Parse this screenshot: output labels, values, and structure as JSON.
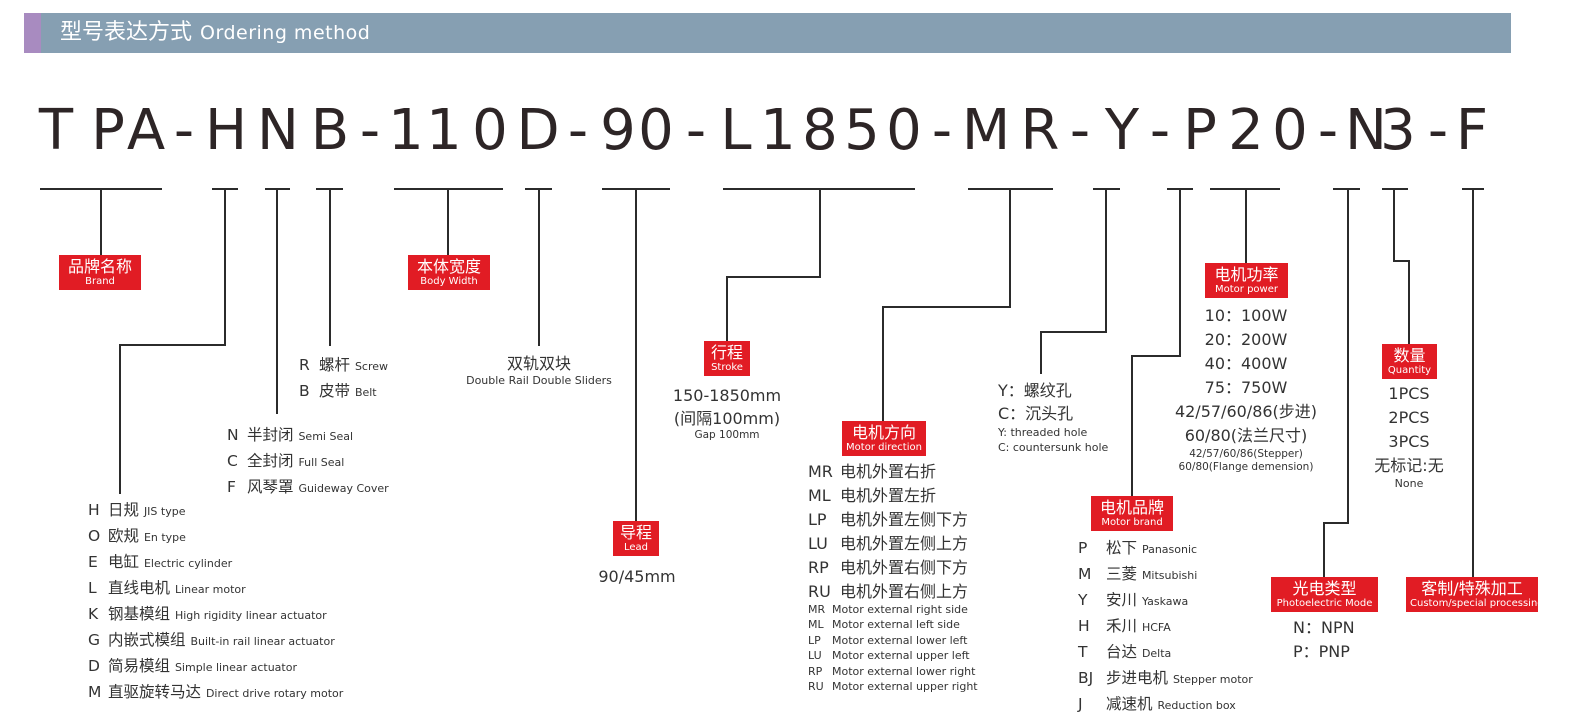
{
  "header": {
    "title_zh": "型号表达方式",
    "title_en": "Ordering method"
  },
  "model_code": [
    "T",
    "P",
    "A",
    "-",
    "H",
    "N",
    "B",
    "-",
    "1",
    "1",
    "0",
    "D",
    "-",
    "9",
    "0",
    "-",
    "L",
    "1",
    "8",
    "5",
    "0",
    "-",
    "M",
    "R",
    "-",
    "Y",
    "-",
    "P",
    "2",
    "0",
    "-",
    "N",
    "3",
    "-",
    "F"
  ],
  "tags": {
    "brand": {
      "zh": "品牌名称",
      "en": "Brand"
    },
    "body_width": {
      "zh": "本体宽度",
      "en": "Body Width"
    },
    "stroke": {
      "zh": "行程",
      "en": "Stroke"
    },
    "lead": {
      "zh": "导程",
      "en": "Lead"
    },
    "motor_direction": {
      "zh": "电机方向",
      "en": "Motor direction"
    },
    "motor_power": {
      "zh": "电机功率",
      "en": "Motor power"
    },
    "motor_brand": {
      "zh": "电机品牌",
      "en": "Motor brand"
    },
    "quantity": {
      "zh": "数量",
      "en": "Quantity"
    },
    "photoelectric": {
      "zh": "光电类型",
      "en": "Photoelectric Mode"
    },
    "custom": {
      "zh": "客制/特殊加工",
      "en": "Custom/special processing"
    }
  },
  "type_options": [
    {
      "code": "H",
      "zh": "日规",
      "en": "JIS type"
    },
    {
      "code": "O",
      "zh": "欧规",
      "en": "En type"
    },
    {
      "code": "E",
      "zh": "电缸",
      "en": "Electric cylinder"
    },
    {
      "code": "L",
      "zh": "直线电机",
      "en": "Linear motor"
    },
    {
      "code": "K",
      "zh": "钢基模组",
      "en": "High rigidity linear actuator"
    },
    {
      "code": "G",
      "zh": "内嵌式模组",
      "en": "Built-in rail linear actuator"
    },
    {
      "code": "D",
      "zh": "简易模组",
      "en": "Simple linear actuator"
    },
    {
      "code": "M",
      "zh": "直驱旋转马达",
      "en": "Direct drive rotary motor"
    }
  ],
  "seal_options": [
    {
      "code": "N",
      "zh": "半封闭",
      "en": "Semi Seal"
    },
    {
      "code": "C",
      "zh": "全封闭",
      "en": "Full Seal"
    },
    {
      "code": "F",
      "zh": "风琴罩",
      "en": "Guideway Cover"
    }
  ],
  "drive_options": [
    {
      "code": "R",
      "zh": "螺杆",
      "en": "Screw"
    },
    {
      "code": "B",
      "zh": "皮带",
      "en": "Belt"
    }
  ],
  "slider": {
    "zh": "双轨双块",
    "en": "Double Rail Double Sliders"
  },
  "stroke_info": {
    "range": "150-1850mm",
    "gap_zh": "(间隔100mm)",
    "gap_en": "Gap 100mm"
  },
  "lead_info": {
    "value": "90/45mm"
  },
  "direction_options": [
    {
      "code": "MR",
      "zh": "电机外置右折",
      "en": "Motor external right side"
    },
    {
      "code": "ML",
      "zh": "电机外置左折",
      "en": "Motor external left side"
    },
    {
      "code": "LP",
      "zh": "电机外置左侧下方",
      "en": "Motor external lower left"
    },
    {
      "code": "LU",
      "zh": "电机外置左侧上方",
      "en": "Motor external upper left"
    },
    {
      "code": "RP",
      "zh": "电机外置右侧下方",
      "en": "Motor external lower right"
    },
    {
      "code": "RU",
      "zh": "电机外置右侧上方",
      "en": "Motor external upper right"
    }
  ],
  "hole_options": {
    "zh": [
      "Y：螺纹孔",
      "C：沉头孔"
    ],
    "en": [
      "Y: threaded hole",
      "C: countersunk hole"
    ]
  },
  "power_options": {
    "items": [
      "10：100W",
      "20：200W",
      "40：400W",
      "75：750W",
      "42/57/60/86(步进)",
      "60/80(法兰尺寸)"
    ],
    "notes": [
      "42/57/60/86(Stepper)",
      "60/80(Flange demension)"
    ]
  },
  "brand_options": [
    {
      "code": "P",
      "zh": "松下",
      "en": "Panasonic"
    },
    {
      "code": "M",
      "zh": "三菱",
      "en": "Mitsubishi"
    },
    {
      "code": "Y",
      "zh": "安川",
      "en": "Yaskawa"
    },
    {
      "code": "H",
      "zh": "禾川",
      "en": "HCFA"
    },
    {
      "code": "T",
      "zh": "台达",
      "en": "Delta"
    },
    {
      "code": "BJ",
      "zh": "步进电机",
      "en": "Stepper motor"
    },
    {
      "code": "J",
      "zh": "减速机",
      "en": "Reduction box"
    }
  ],
  "quantity_options": {
    "items": [
      "1PCS",
      "2PCS",
      "3PCS",
      "无标记:无"
    ],
    "note": "None"
  },
  "photo_options": [
    "N：NPN",
    "P：PNP"
  ],
  "colors": {
    "header_bg": "#869fb2",
    "header_accent": "#a88bc0",
    "tag_red": "#e11c24",
    "text": "#333333"
  }
}
